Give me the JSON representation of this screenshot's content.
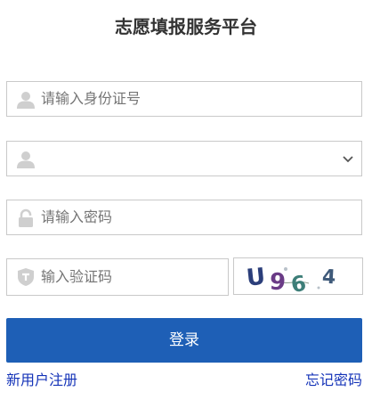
{
  "page_title": "志愿填报服务平台",
  "id_field": {
    "placeholder": "请输入身份证号",
    "icon": "user-icon"
  },
  "role_select": {
    "selected": "",
    "icon": "user-icon"
  },
  "password_field": {
    "placeholder": "请输入密码",
    "icon": "lock-icon"
  },
  "captcha_field": {
    "placeholder": "输入验证码",
    "icon": "shield-icon"
  },
  "captcha_image": {
    "chars": [
      "U",
      "9",
      "6",
      "4"
    ]
  },
  "login_button": "登录",
  "links": {
    "register": "新用户注册",
    "forgot": "忘记密码"
  },
  "colors": {
    "primary": "#1e5fb6",
    "link": "#1433b8",
    "border": "#c9c9c9",
    "icon": "#cfcfcf"
  }
}
